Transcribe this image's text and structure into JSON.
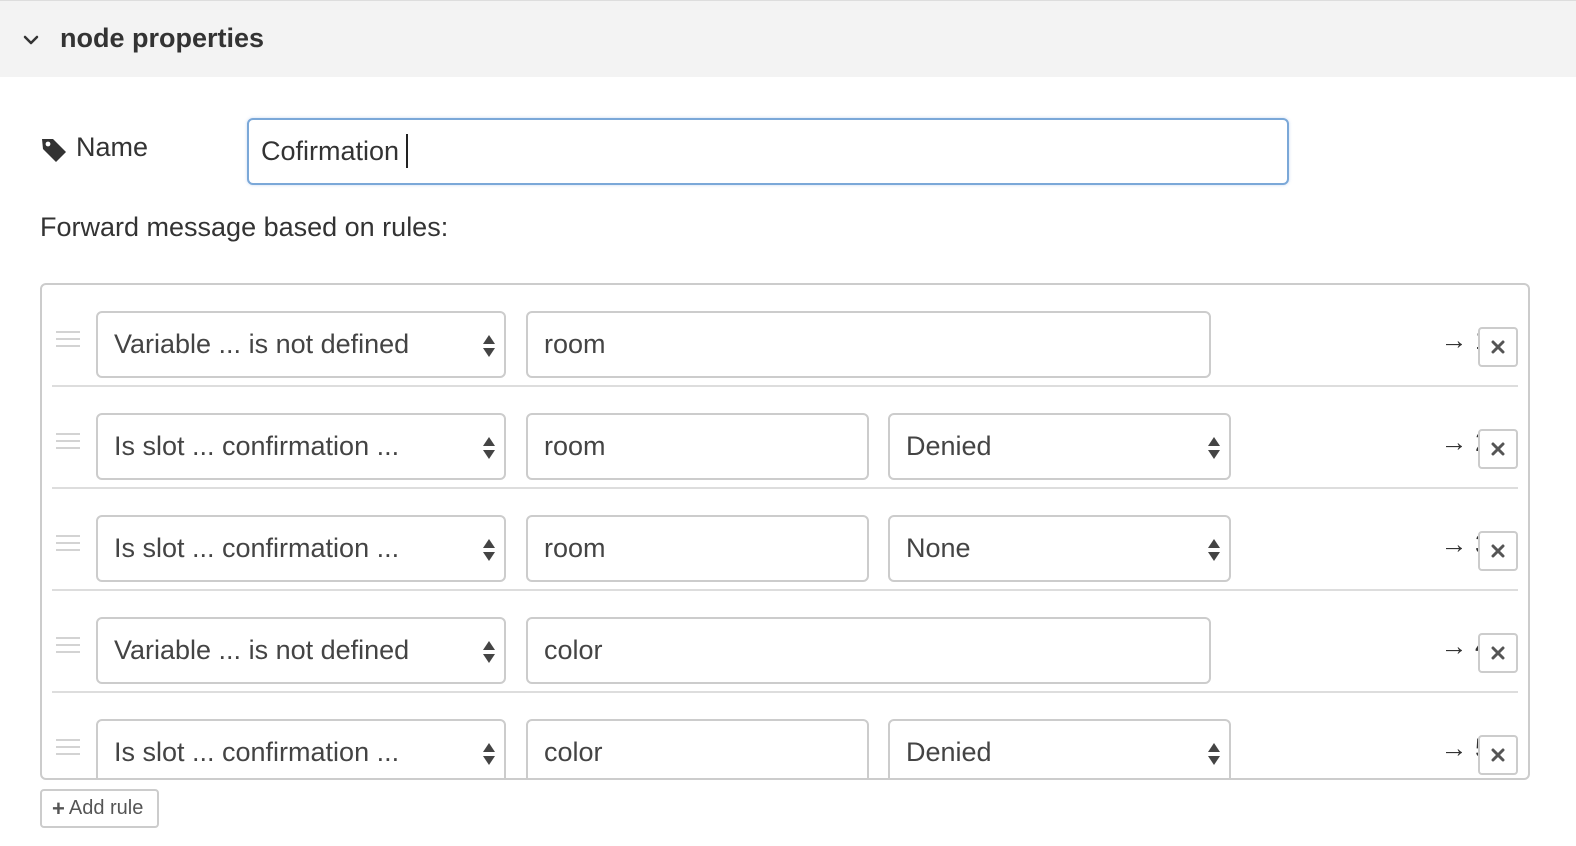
{
  "header": {
    "title": "node properties",
    "collapse_icon": "chevron-down-icon"
  },
  "name": {
    "label": "Name",
    "icon": "tag-icon",
    "value": "Cofirmation"
  },
  "rules_label": "Forward message based on rules:",
  "rules": [
    {
      "condition": "Variable ... is not defined",
      "value": "room",
      "state": "",
      "output": "→ 1"
    },
    {
      "condition": "Is slot ... confirmation ...",
      "value": "room",
      "state": "Denied",
      "output": "→ 2"
    },
    {
      "condition": "Is slot ... confirmation ...",
      "value": "room",
      "state": "None",
      "output": "→ 3"
    },
    {
      "condition": "Variable ... is not defined",
      "value": "color",
      "state": "",
      "output": "→ 4"
    },
    {
      "condition": "Is slot ... confirmation ...",
      "value": "color",
      "state": "Denied",
      "output": "→ 5"
    }
  ],
  "add_rule_label": "Add rule"
}
